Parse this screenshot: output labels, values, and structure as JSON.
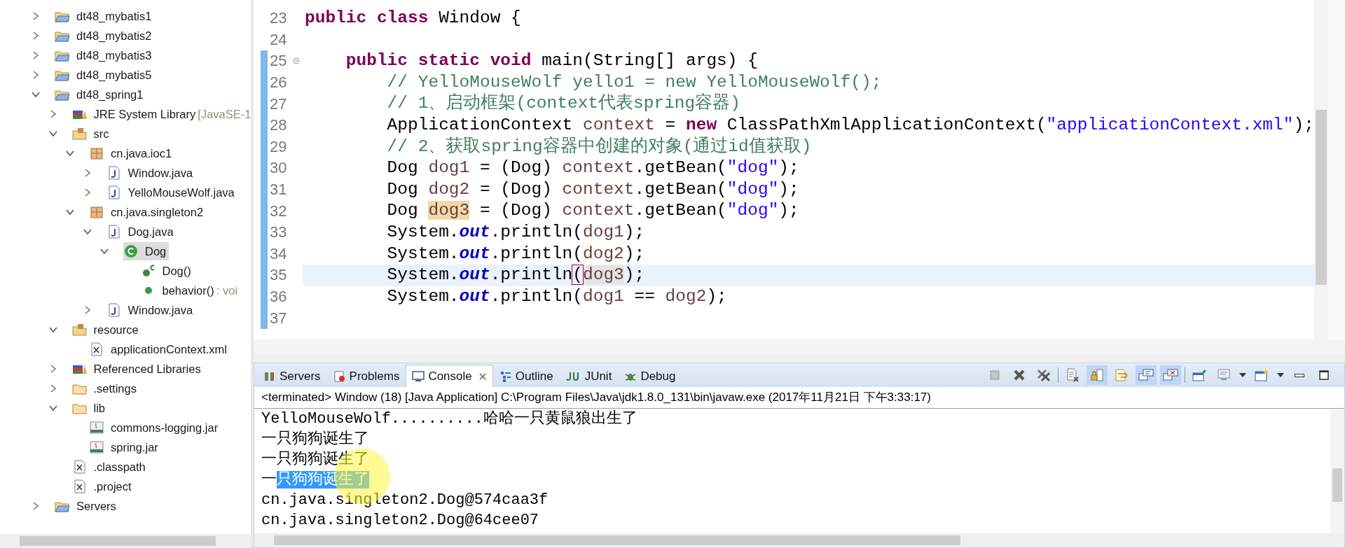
{
  "project_explorer": {
    "items": [
      {
        "label": "dt48_mybatis1",
        "kind": "project",
        "expanded": false,
        "selected": false
      },
      {
        "label": "dt48_mybatis2",
        "kind": "project",
        "expanded": false,
        "selected": false
      },
      {
        "label": "dt48_mybatis3",
        "kind": "project",
        "expanded": false,
        "selected": false
      },
      {
        "label": "dt48_mybatis5",
        "kind": "project",
        "expanded": false,
        "selected": false
      },
      {
        "label": "dt48_spring1",
        "kind": "project",
        "expanded": true,
        "selected": false,
        "children": [
          {
            "label": "JRE System Library",
            "decoration": "[JavaSE-1",
            "kind": "library",
            "expanded": false,
            "selected": false
          },
          {
            "label": "src",
            "kind": "source-folder",
            "expanded": true,
            "selected": false,
            "children": [
              {
                "label": "cn.java.ioc1",
                "kind": "package",
                "expanded": true,
                "selected": false,
                "children": [
                  {
                    "label": "Window.java",
                    "kind": "java-file",
                    "expanded": false,
                    "selected": false
                  },
                  {
                    "label": "YelloMouseWolf.java",
                    "kind": "java-file",
                    "expanded": false,
                    "selected": false
                  }
                ]
              },
              {
                "label": "cn.java.singleton2",
                "kind": "package",
                "expanded": true,
                "selected": false,
                "children": [
                  {
                    "label": "Dog.java",
                    "kind": "java-file",
                    "expanded": true,
                    "selected": false,
                    "children": [
                      {
                        "label": "Dog",
                        "kind": "class",
                        "expanded": true,
                        "selected": true,
                        "children": [
                          {
                            "label": "Dog()",
                            "kind": "constructor",
                            "selected": false
                          },
                          {
                            "label": "behavior()",
                            "decoration": ": voi",
                            "kind": "method",
                            "selected": false
                          }
                        ]
                      }
                    ]
                  },
                  {
                    "label": "Window.java",
                    "kind": "java-file",
                    "expanded": false,
                    "selected": false
                  }
                ]
              }
            ]
          },
          {
            "label": "resource",
            "kind": "source-folder",
            "expanded": true,
            "selected": false,
            "children": [
              {
                "label": "applicationContext.xml",
                "kind": "xml-file",
                "selected": false
              }
            ]
          },
          {
            "label": "Referenced Libraries",
            "kind": "library",
            "expanded": false,
            "selected": false
          },
          {
            "label": ".settings",
            "kind": "folder",
            "expanded": false,
            "selected": false
          },
          {
            "label": "lib",
            "kind": "folder",
            "expanded": true,
            "selected": false,
            "children": [
              {
                "label": "commons-logging.jar",
                "kind": "jar",
                "selected": false
              },
              {
                "label": "spring.jar",
                "kind": "jar",
                "selected": false
              }
            ]
          },
          {
            "label": ".classpath",
            "kind": "xml-file",
            "selected": false
          },
          {
            "label": ".project",
            "kind": "xml-file",
            "selected": false
          }
        ]
      },
      {
        "label": "Servers",
        "kind": "project",
        "expanded": false,
        "selected": false
      }
    ]
  },
  "editor": {
    "lines": [
      {
        "number": "23",
        "changed": false,
        "current": false,
        "fold_marker": false,
        "tokens": [
          {
            "text": "public",
            "kind": "keyword"
          },
          {
            "text": " class",
            "kind": "keyword"
          },
          {
            "text": " Window {",
            "kind": "plain"
          }
        ]
      },
      {
        "number": "24",
        "changed": false,
        "current": false,
        "fold_marker": false
      },
      {
        "number": "25",
        "changed": true,
        "current": false,
        "fold_marker": true,
        "tokens": [
          {
            "text": "    public",
            "kind": "keyword"
          },
          {
            "text": " static",
            "kind": "keyword"
          },
          {
            "text": " void",
            "kind": "keyword"
          },
          {
            "text": " main(String[] args) {",
            "kind": "plain"
          }
        ]
      },
      {
        "number": "26",
        "changed": true,
        "current": false,
        "fold_marker": false,
        "tokens": [
          {
            "text": "        // YelloMouseWolf yello1 = new YelloMouseWolf();",
            "kind": "comment"
          }
        ]
      },
      {
        "number": "27",
        "changed": true,
        "current": false,
        "fold_marker": false,
        "tokens": [
          {
            "text": "        // 1、启动框架(context代表spring容器)",
            "kind": "comment"
          }
        ]
      },
      {
        "number": "28",
        "changed": true,
        "current": false,
        "fold_marker": false,
        "tokens": [
          {
            "text": "        ApplicationContext ",
            "kind": "plain"
          },
          {
            "text": "context",
            "kind": "local"
          },
          {
            "text": " = ",
            "kind": "plain"
          },
          {
            "text": "new",
            "kind": "keyword"
          },
          {
            "text": " ClassPathXmlApplicationContext(",
            "kind": "plain"
          },
          {
            "text": "\"applicationContext.xml\"",
            "kind": "string"
          },
          {
            "text": ");",
            "kind": "plain"
          }
        ]
      },
      {
        "number": "29",
        "changed": true,
        "current": false,
        "fold_marker": false,
        "tokens": [
          {
            "text": "        // 2、获取spring容器中创建的对象(通过id值获取)",
            "kind": "comment"
          }
        ]
      },
      {
        "number": "30",
        "changed": true,
        "current": false,
        "fold_marker": false,
        "tokens": [
          {
            "text": "        Dog ",
            "kind": "plain"
          },
          {
            "text": "dog1",
            "kind": "local"
          },
          {
            "text": " = (Dog) ",
            "kind": "plain"
          },
          {
            "text": "context",
            "kind": "local"
          },
          {
            "text": ".getBean(",
            "kind": "plain"
          },
          {
            "text": "\"dog\"",
            "kind": "string"
          },
          {
            "text": ");",
            "kind": "plain"
          }
        ]
      },
      {
        "number": "31",
        "changed": true,
        "current": false,
        "fold_marker": false,
        "tokens": [
          {
            "text": "        Dog ",
            "kind": "plain"
          },
          {
            "text": "dog2",
            "kind": "local"
          },
          {
            "text": " = (Dog) ",
            "kind": "plain"
          },
          {
            "text": "context",
            "kind": "local"
          },
          {
            "text": ".getBean(",
            "kind": "plain"
          },
          {
            "text": "\"dog\"",
            "kind": "string"
          },
          {
            "text": ");",
            "kind": "plain"
          }
        ]
      },
      {
        "number": "32",
        "changed": true,
        "current": false,
        "fold_marker": false,
        "tokens": [
          {
            "text": "        Dog ",
            "kind": "plain"
          },
          {
            "text": "dog3",
            "kind": "local",
            "occurrence": true,
            "write": true
          },
          {
            "text": " = (Dog) ",
            "kind": "plain"
          },
          {
            "text": "context",
            "kind": "local"
          },
          {
            "text": ".getBean(",
            "kind": "plain"
          },
          {
            "text": "\"dog\"",
            "kind": "string"
          },
          {
            "text": ");",
            "kind": "plain"
          }
        ]
      },
      {
        "number": "33",
        "changed": true,
        "current": false,
        "fold_marker": false,
        "tokens": [
          {
            "text": "        System.",
            "kind": "plain"
          },
          {
            "text": "out",
            "kind": "field"
          },
          {
            "text": ".println(",
            "kind": "plain"
          },
          {
            "text": "dog1",
            "kind": "local"
          },
          {
            "text": ");",
            "kind": "plain"
          }
        ]
      },
      {
        "number": "34",
        "changed": true,
        "current": false,
        "fold_marker": false,
        "tokens": [
          {
            "text": "        System.",
            "kind": "plain"
          },
          {
            "text": "out",
            "kind": "field"
          },
          {
            "text": ".println(",
            "kind": "plain"
          },
          {
            "text": "dog2",
            "kind": "local"
          },
          {
            "text": ");",
            "kind": "plain"
          }
        ]
      },
      {
        "number": "35",
        "changed": true,
        "current": true,
        "fold_marker": false,
        "tokens": [
          {
            "text": "        System.",
            "kind": "plain"
          },
          {
            "text": "out",
            "kind": "field"
          },
          {
            "text": ".println",
            "kind": "plain"
          },
          {
            "text": "(",
            "kind": "bracket"
          },
          {
            "text": "dog3",
            "kind": "local",
            "occurrence": true,
            "write": false
          },
          {
            "text": ");",
            "kind": "plain"
          }
        ]
      },
      {
        "number": "36",
        "changed": true,
        "current": false,
        "fold_marker": false,
        "tokens": [
          {
            "text": "        System.",
            "kind": "plain"
          },
          {
            "text": "out",
            "kind": "field"
          },
          {
            "text": ".println(",
            "kind": "plain"
          },
          {
            "text": "dog1",
            "kind": "local"
          },
          {
            "text": " == ",
            "kind": "plain"
          },
          {
            "text": "dog2",
            "kind": "local"
          },
          {
            "text": ");",
            "kind": "plain"
          }
        ]
      },
      {
        "number": "37",
        "changed": true,
        "current": false,
        "fold_marker": false
      }
    ]
  },
  "console_view": {
    "tabs": [
      {
        "label": "Servers",
        "kind": "servers",
        "selected": false,
        "closable": false
      },
      {
        "label": "Problems",
        "kind": "problems",
        "selected": false,
        "closable": false
      },
      {
        "label": "Console",
        "kind": "console",
        "selected": true,
        "closable": true
      },
      {
        "label": "Outline",
        "kind": "outline",
        "selected": false,
        "closable": false
      },
      {
        "label": "JUnit",
        "kind": "junit",
        "selected": false,
        "closable": false
      },
      {
        "label": "Debug",
        "kind": "debug",
        "selected": false,
        "closable": false
      }
    ],
    "toolbar": [
      {
        "kind": "terminate",
        "selected": false
      },
      {
        "kind": "remove-launch",
        "selected": false
      },
      {
        "kind": "remove-all",
        "selected": false
      },
      {
        "kind": "separator"
      },
      {
        "kind": "clear",
        "selected": false
      },
      {
        "kind": "scroll-lock",
        "selected": true
      },
      {
        "kind": "word-wrap",
        "selected": false
      },
      {
        "kind": "show-stdout",
        "selected": true
      },
      {
        "kind": "show-stderr",
        "selected": true
      },
      {
        "kind": "separator"
      },
      {
        "kind": "pin",
        "selected": false
      },
      {
        "kind": "display",
        "selected": false
      },
      {
        "kind": "dropdown",
        "selected": false
      },
      {
        "kind": "open-console",
        "selected": false
      },
      {
        "kind": "dropdown",
        "selected": false
      },
      {
        "kind": "minimize",
        "selected": false
      },
      {
        "kind": "maximize",
        "selected": false
      }
    ],
    "status": "<terminated> Window (18) [Java Application] C:\\Program Files\\Java\\jdk1.8.0_131\\bin\\javaw.exe (2017年11月21日 下午3:33:17)",
    "lines": [
      {
        "parts": [
          {
            "text": "YelloMouseWolf..........哈哈一只黄鼠狼出生了",
            "selected": false
          }
        ]
      },
      {
        "parts": [
          {
            "text": "一只狗狗诞生了",
            "selected": false
          }
        ]
      },
      {
        "parts": [
          {
            "text": "一只狗狗诞生了",
            "selected": false
          }
        ]
      },
      {
        "parts": [
          {
            "text": "一",
            "selected": false
          },
          {
            "text": "只狗狗诞生了",
            "selected": true
          }
        ]
      },
      {
        "parts": [
          {
            "text": "cn.java.singleton2.Dog@574caa3f",
            "selected": false
          }
        ]
      },
      {
        "parts": [
          {
            "text": "cn.java.singleton2.Dog@64cee07",
            "selected": false
          }
        ]
      }
    ]
  }
}
